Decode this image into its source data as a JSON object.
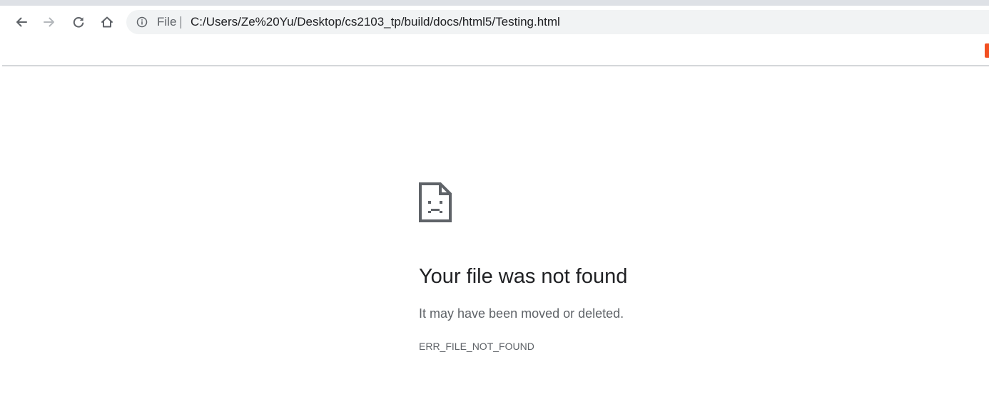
{
  "browser": {
    "toolbar": {
      "back_icon": "arrow-left-icon",
      "forward_icon": "arrow-right-icon",
      "reload_icon": "reload-icon",
      "home_icon": "home-icon"
    },
    "omnibox": {
      "security_icon": "info-circle-icon",
      "scheme_label": "File",
      "url": "C:/Users/Ze%20Yu/Desktop/cs2103_tp/build/docs/html5/Testing.html"
    }
  },
  "error_page": {
    "icon": "sad-file-icon",
    "title": "Your file was not found",
    "message": "It may have been moved or deleted.",
    "code": "ERR_FILE_NOT_FOUND"
  },
  "colors": {
    "title_text": "#202124",
    "secondary_text": "#5f6368",
    "omnibox_bg": "#f1f3f4",
    "icon_gray": "#5f6368",
    "forward_disabled": "#b4b8bc",
    "bookmark_accent": "#f25022"
  }
}
